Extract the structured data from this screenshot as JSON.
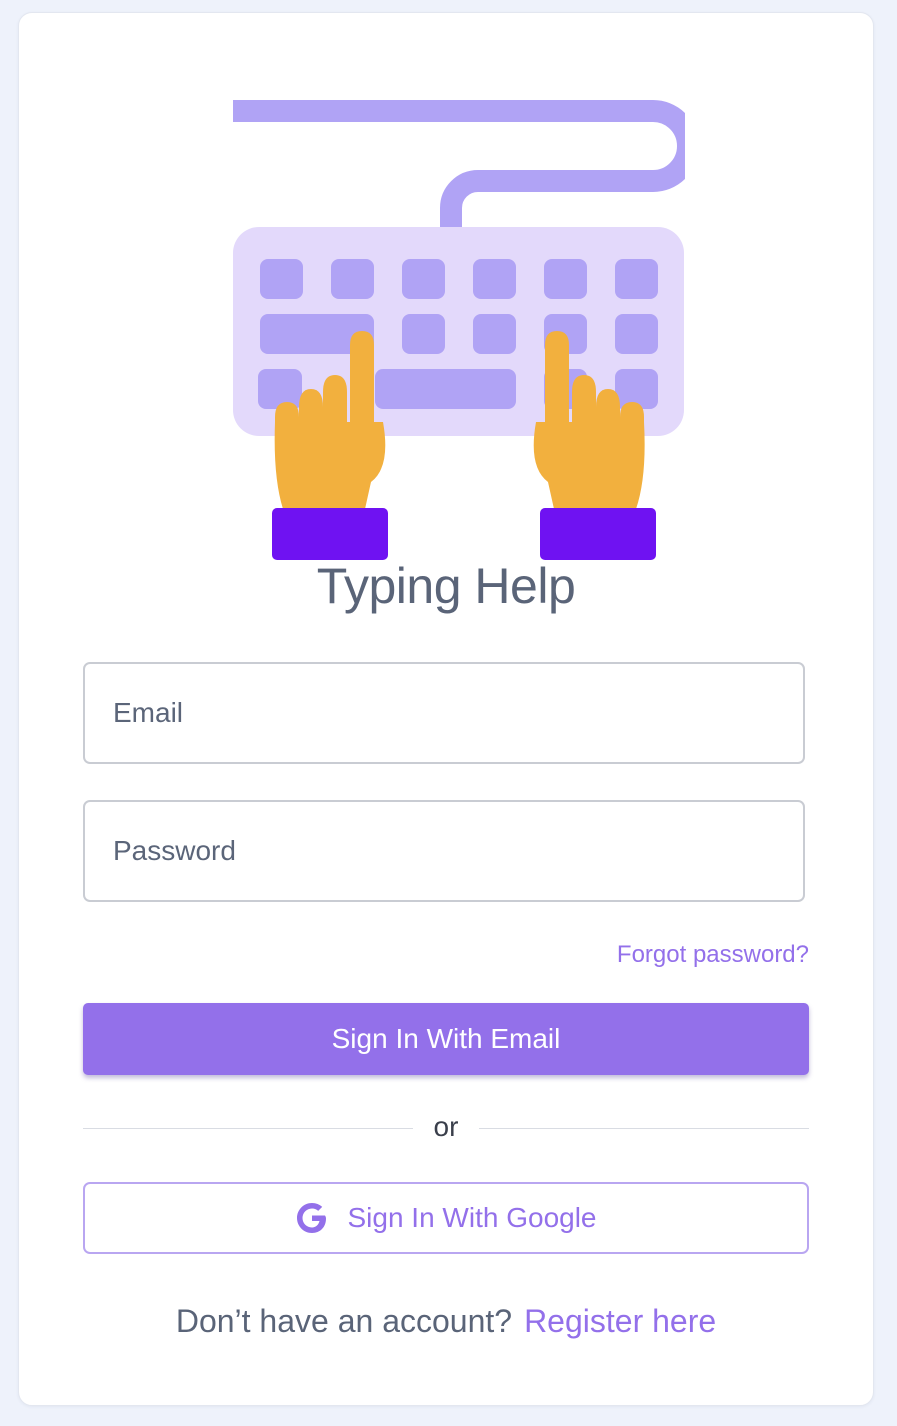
{
  "app": {
    "title": "Typing Help",
    "illustration_icon": "keyboard-with-hands-icon"
  },
  "form": {
    "email_placeholder": "Email",
    "password_placeholder": "Password",
    "email_value": "",
    "password_value": "",
    "forgot_password": "Forgot password?",
    "sign_in_email": "Sign In With Email",
    "divider": "or",
    "sign_in_google": "Sign In With Google",
    "google_icon": "google-g-icon"
  },
  "footer": {
    "no_account": "Don’t have an account?",
    "register": "Register here"
  },
  "colors": {
    "accent": "#9370ea",
    "keyboard_light": "#e3d9fb",
    "keyboard_keys": "#b0a3f5",
    "hand": "#f2b03e",
    "cuff": "#6f12f2",
    "text_muted": "#5a6478"
  }
}
